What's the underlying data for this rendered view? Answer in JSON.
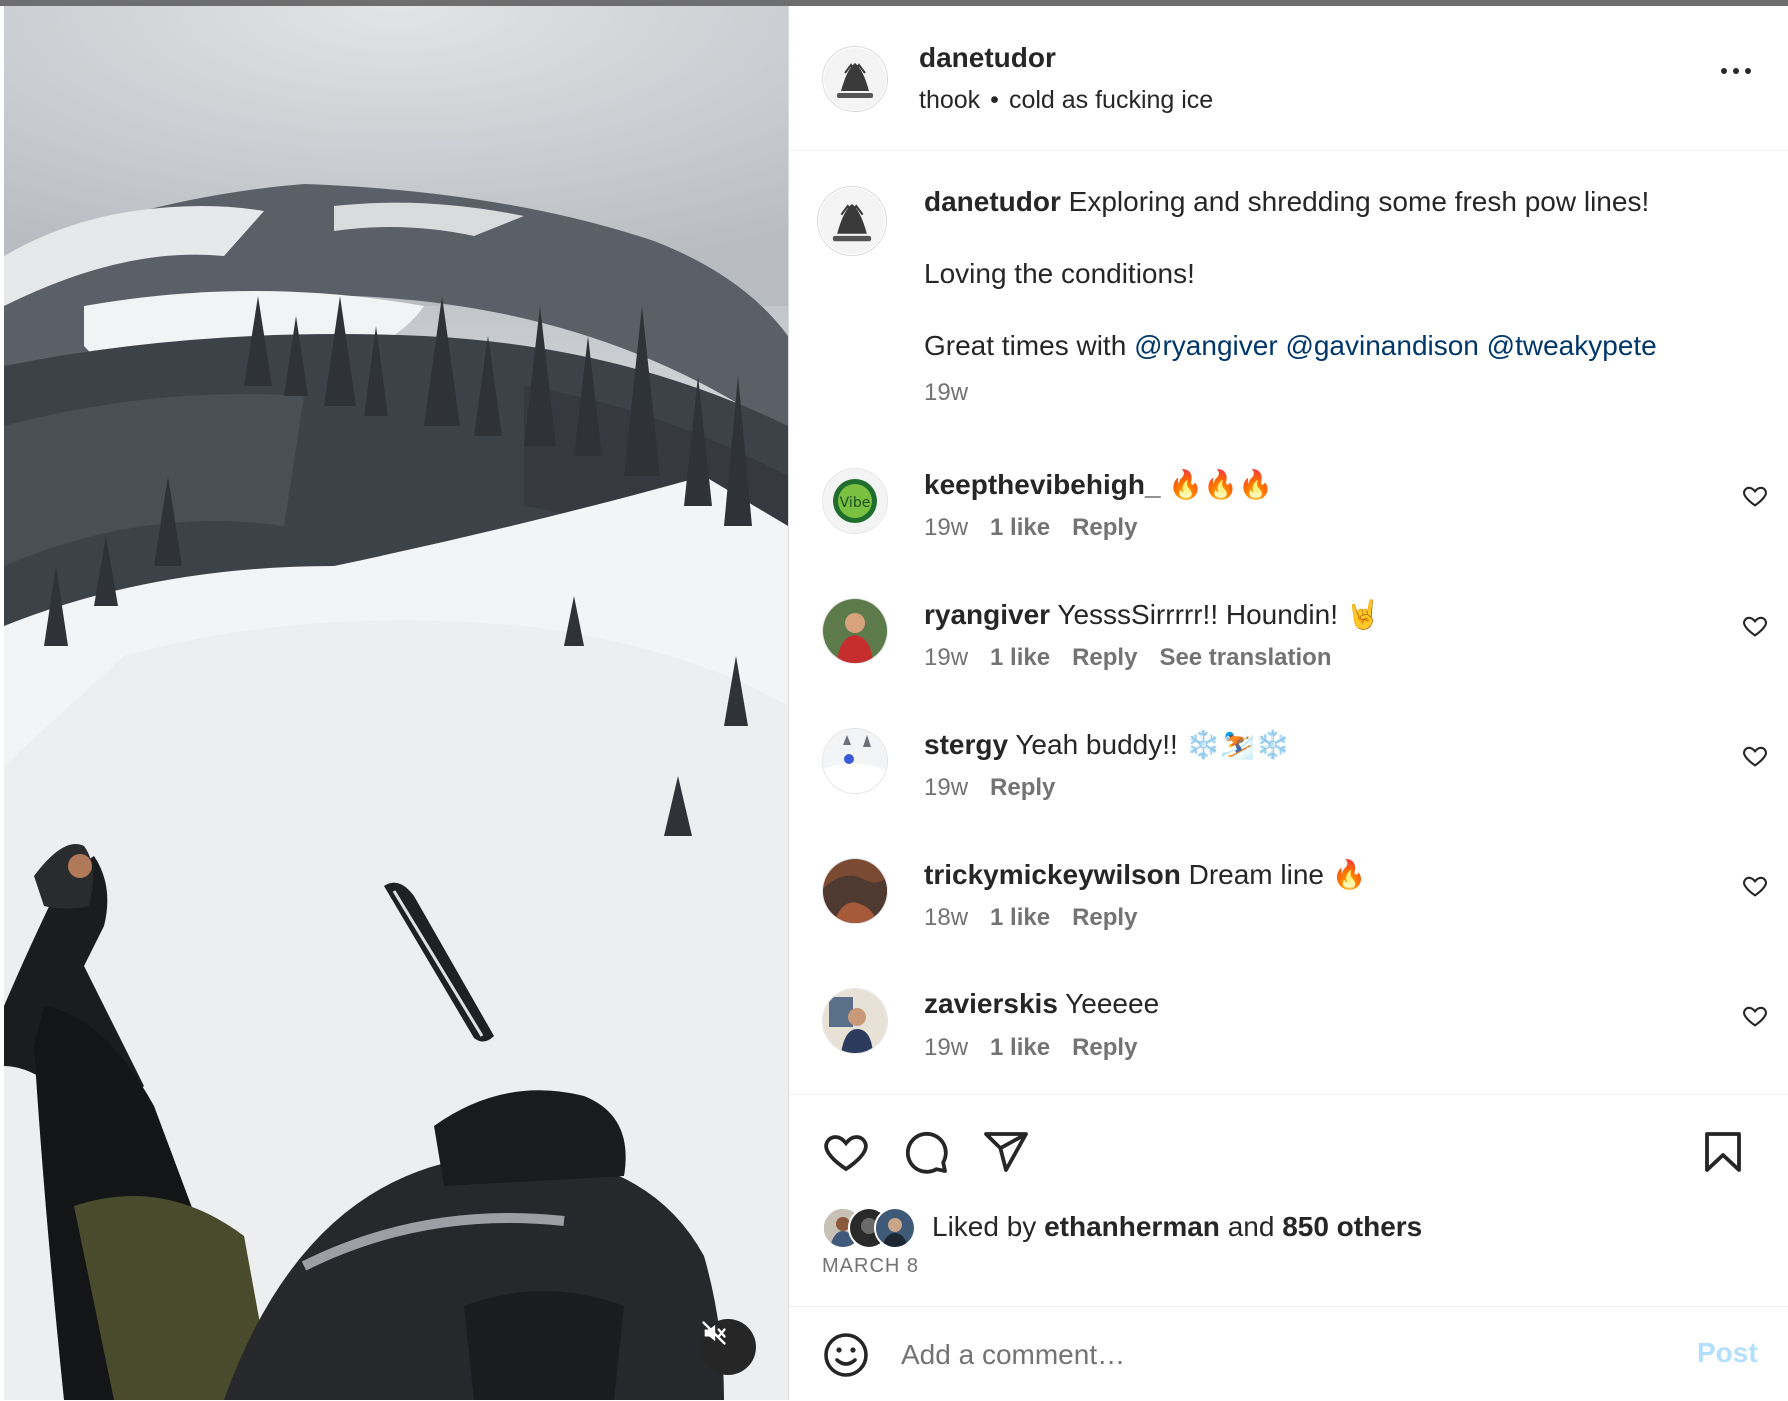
{
  "post": {
    "username": "danetudor",
    "audio": "thook",
    "location": "cold as fucking ice",
    "caption_line1": "Exploring and shredding some fresh pow lines!",
    "caption_line2": "Loving the conditions!",
    "caption_line3_prefix": "Great times with",
    "mentions": [
      "@ryangiver",
      "@gavinandison",
      "@tweakypete"
    ],
    "caption_time": "19w",
    "bullet": "•"
  },
  "comments": [
    {
      "username": "keepthevibehigh_",
      "text": "🔥🔥🔥",
      "time": "19w",
      "likes": "1 like",
      "reply": "Reply",
      "extra": ""
    },
    {
      "username": "ryangiver",
      "text": "YesssSirrrrr!! Houndin! 🤘",
      "time": "19w",
      "likes": "1 like",
      "reply": "Reply",
      "extra": "See translation"
    },
    {
      "username": "stergy",
      "text": "Yeah buddy!! ❄️⛷️❄️",
      "time": "19w",
      "likes": "",
      "reply": "Reply",
      "extra": ""
    },
    {
      "username": "trickymickeywilson",
      "text": "Dream line 🔥",
      "time": "18w",
      "likes": "1 like",
      "reply": "Reply",
      "extra": ""
    },
    {
      "username": "zavierskis",
      "text": "Yeeeee",
      "time": "19w",
      "likes": "1 like",
      "reply": "Reply",
      "extra": ""
    }
  ],
  "likes": {
    "prefix": "Liked by",
    "user": "ethanherman",
    "and": "and",
    "others": "850 others"
  },
  "date": "MARCH 8",
  "add_comment": {
    "placeholder": "Add a comment…",
    "post_label": "Post"
  },
  "icons": {
    "more": "more-options-icon",
    "like": "heart-icon",
    "comment": "comment-icon",
    "share": "share-icon",
    "save": "bookmark-icon",
    "emoji": "emoji-icon",
    "mute": "muted-speaker-icon"
  },
  "colors": {
    "mention": "#00376b",
    "muted_text": "#737373",
    "post_button_disabled": "#b2dffc"
  }
}
